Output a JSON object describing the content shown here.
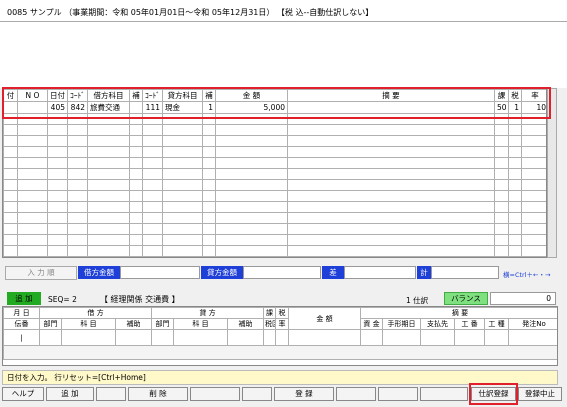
{
  "title": "0085 サンプル （事業期間：令和 05年01月01日～令和 05年12月31日） 【税 込--自動仕訳しない】",
  "grid": {
    "headers": [
      "付",
      "N O",
      "日付",
      "ｺｰﾄﾞ",
      "借方科目",
      "補",
      "ｺｰﾄﾞ",
      "貸方科目",
      "補",
      "金 額",
      "摘 要",
      "課",
      "税",
      "率"
    ],
    "rows": [
      [
        "",
        "",
        "405",
        "842",
        "旅費交通",
        "",
        "111",
        "現金",
        "1",
        "5,000",
        "",
        "50",
        "1",
        "10"
      ]
    ]
  },
  "summary": {
    "input_order": "入 力 順",
    "debit_total": "借方金額",
    "credit_total": "貸方金額",
    "diff": "差",
    "total": "計",
    "hint": "横=Ctrl＋←・→"
  },
  "entry": {
    "add_label": "追 加",
    "seq": "SEQ= 2",
    "category": "【 経理関係 交通費 】",
    "journal_count": "1 仕訳",
    "balance_label": "バランス",
    "balance_value": "0",
    "h1": [
      "月 日",
      "借 方",
      "貸 方",
      "課",
      "税",
      "金 額",
      "摘 要"
    ],
    "h2": [
      "伝番",
      "部門",
      "科 目",
      "補助",
      "部門",
      "科 目",
      "補助",
      "税区",
      "率",
      "資 金",
      "手形期日",
      "支払先",
      "工 番",
      "工 種",
      "発注No"
    ]
  },
  "status": "日付を入力。 行リセット=[Ctrl+Home]",
  "footer": {
    "help": "ヘルプ",
    "add": "追 加",
    "delete": "削 除",
    "register": "登 録",
    "journal_register": "仕訳登録",
    "register_cancel": "登録中止"
  }
}
